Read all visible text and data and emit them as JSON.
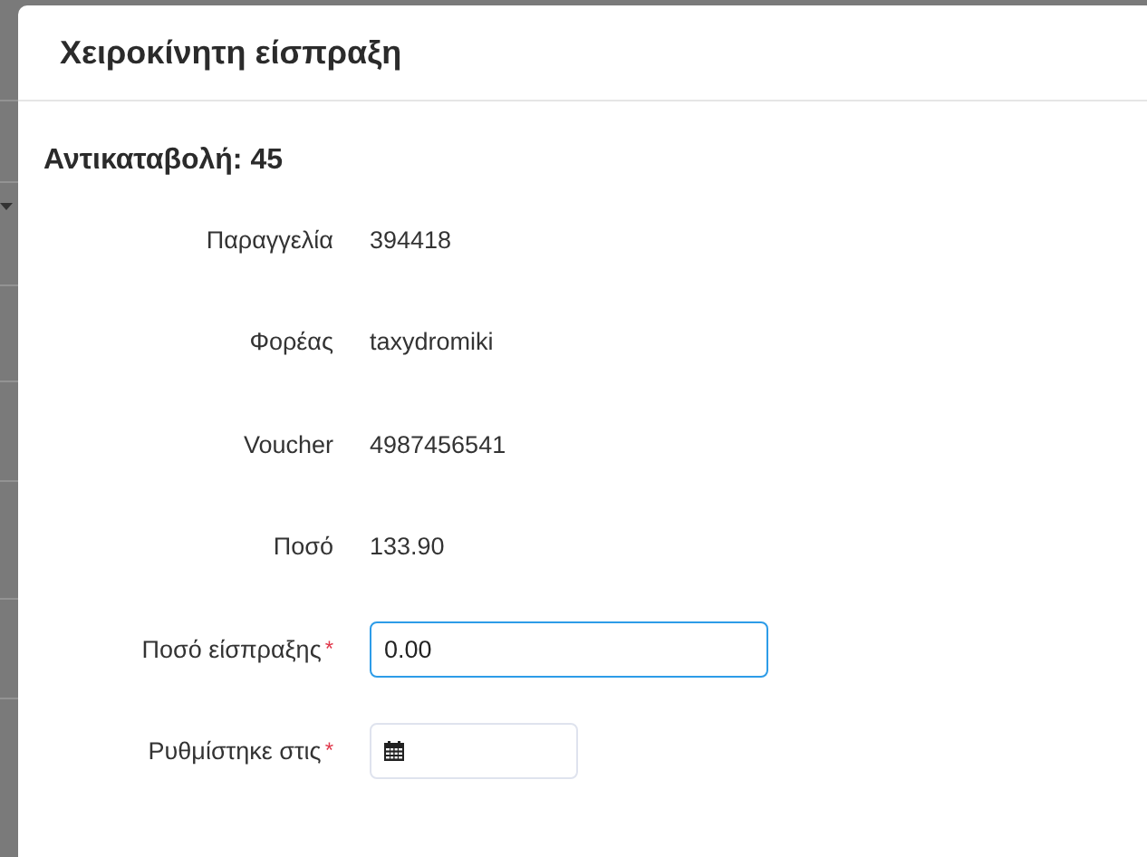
{
  "dialog": {
    "title": "Χειροκίνητη είσπραξη"
  },
  "section": {
    "heading": "Αντικαταβολή: 45"
  },
  "details": [
    {
      "label": "Παραγγελία",
      "value": "394418"
    },
    {
      "label": "Φορέας",
      "value": "taxydromiki"
    },
    {
      "label": "Voucher",
      "value": "4987456541"
    },
    {
      "label": "Ποσό",
      "value": "133.90"
    }
  ],
  "fields": [
    {
      "kind": "text",
      "label": "Ποσό είσπραξης",
      "required_mark": "*",
      "value": "0.00",
      "focused": true
    },
    {
      "kind": "date",
      "label": "Ρυθμίστηκε στις",
      "required_mark": "*",
      "focused": false
    }
  ]
}
